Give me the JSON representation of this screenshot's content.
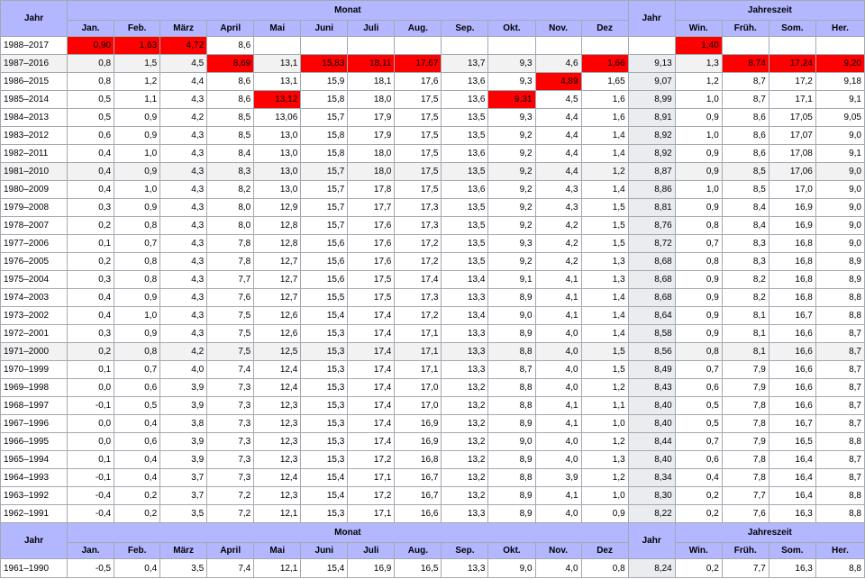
{
  "headers": {
    "jahr": "Jahr",
    "monat": "Monat",
    "jahreszeit": "Jahreszeit",
    "months": [
      "Jan.",
      "Feb.",
      "März",
      "April",
      "Mai",
      "Juni",
      "Juli",
      "Aug.",
      "Sep.",
      "Okt.",
      "Nov.",
      "Dez"
    ],
    "seasons": [
      "Win.",
      "Früh.",
      "Som.",
      "Her."
    ]
  },
  "highlight_color": "#ff0000",
  "rows": [
    {
      "period": "1988–2017",
      "months": [
        "0,90",
        "1,63",
        "4,72",
        "8,6",
        "",
        "",
        "",
        "",
        "",
        "",
        "",
        ""
      ],
      "jahr": "",
      "seasons": [
        "1,40",
        "",
        "",
        ""
      ],
      "red": [
        0,
        1,
        2,
        13
      ],
      "alt": false
    },
    {
      "period": "1987–2016",
      "months": [
        "0,8",
        "1,5",
        "4,5",
        "8,69",
        "13,1",
        "15,83",
        "18,11",
        "17,67",
        "13,7",
        "9,3",
        "4,6",
        "1,66"
      ],
      "jahr": "9,13",
      "seasons": [
        "1,3",
        "8,74",
        "17,24",
        "9,20"
      ],
      "red": [
        3,
        5,
        6,
        7,
        11,
        14,
        15,
        16
      ],
      "alt": true
    },
    {
      "period": "1986–2015",
      "months": [
        "0,8",
        "1,2",
        "4,4",
        "8,6",
        "13,1",
        "15,9",
        "18,1",
        "17,6",
        "13,6",
        "9,3",
        "4,89",
        "1,65"
      ],
      "jahr": "9,07",
      "seasons": [
        "1,2",
        "8,7",
        "17,2",
        "9,18"
      ],
      "red": [
        10
      ],
      "alt": false
    },
    {
      "period": "1985–2014",
      "months": [
        "0,5",
        "1,1",
        "4,3",
        "8,6",
        "13,12",
        "15,8",
        "18,0",
        "17,5",
        "13,6",
        "9,31",
        "4,5",
        "1,6"
      ],
      "jahr": "8,99",
      "seasons": [
        "1,0",
        "8,7",
        "17,1",
        "9,1"
      ],
      "red": [
        4,
        9
      ],
      "alt": false
    },
    {
      "period": "1984–2013",
      "months": [
        "0,5",
        "0,9",
        "4,2",
        "8,5",
        "13,06",
        "15,7",
        "17,9",
        "17,5",
        "13,5",
        "9,3",
        "4,4",
        "1,6"
      ],
      "jahr": "8,91",
      "seasons": [
        "0,9",
        "8,6",
        "17,05",
        "9,05"
      ],
      "red": [],
      "alt": false
    },
    {
      "period": "1983–2012",
      "months": [
        "0,6",
        "0,9",
        "4,3",
        "8,5",
        "13,0",
        "15,8",
        "17,9",
        "17,5",
        "13,5",
        "9,2",
        "4,4",
        "1,4"
      ],
      "jahr": "8,92",
      "seasons": [
        "1,0",
        "8,6",
        "17,07",
        "9,0"
      ],
      "red": [],
      "alt": false
    },
    {
      "period": "1982–2011",
      "months": [
        "0,4",
        "1,0",
        "4,3",
        "8,4",
        "13,0",
        "15,8",
        "18,0",
        "17,5",
        "13,6",
        "9,2",
        "4,4",
        "1,4"
      ],
      "jahr": "8,92",
      "seasons": [
        "0,9",
        "8,6",
        "17,08",
        "9,1"
      ],
      "red": [],
      "alt": false
    },
    {
      "period": "1981–2010",
      "months": [
        "0,4",
        "0,9",
        "4,3",
        "8,3",
        "13,0",
        "15,7",
        "18,0",
        "17,5",
        "13,5",
        "9,2",
        "4,4",
        "1,2"
      ],
      "jahr": "8,87",
      "seasons": [
        "0,9",
        "8,5",
        "17,06",
        "9,0"
      ],
      "red": [],
      "alt": true
    },
    {
      "period": "1980–2009",
      "months": [
        "0,4",
        "1,0",
        "4,3",
        "8,2",
        "13,0",
        "15,7",
        "17,8",
        "17,5",
        "13,6",
        "9,2",
        "4,3",
        "1,4"
      ],
      "jahr": "8,86",
      "seasons": [
        "1,0",
        "8,5",
        "17,0",
        "9,0"
      ],
      "red": [],
      "alt": false
    },
    {
      "period": "1979–2008",
      "months": [
        "0,3",
        "0,9",
        "4,3",
        "8,0",
        "12,9",
        "15,7",
        "17,7",
        "17,3",
        "13,5",
        "9,2",
        "4,3",
        "1,5"
      ],
      "jahr": "8,81",
      "seasons": [
        "0,9",
        "8,4",
        "16,9",
        "9,0"
      ],
      "red": [],
      "alt": false
    },
    {
      "period": "1978–2007",
      "months": [
        "0,2",
        "0,8",
        "4,3",
        "8,0",
        "12,8",
        "15,7",
        "17,6",
        "17,3",
        "13,5",
        "9,2",
        "4,2",
        "1,5"
      ],
      "jahr": "8,76",
      "seasons": [
        "0,8",
        "8,4",
        "16,9",
        "9,0"
      ],
      "red": [],
      "alt": false
    },
    {
      "period": "1977–2006",
      "months": [
        "0,1",
        "0,7",
        "4,3",
        "7,8",
        "12,8",
        "15,6",
        "17,6",
        "17,2",
        "13,5",
        "9,3",
        "4,2",
        "1,5"
      ],
      "jahr": "8,72",
      "seasons": [
        "0,7",
        "8,3",
        "16,8",
        "9,0"
      ],
      "red": [],
      "alt": false
    },
    {
      "period": "1976–2005",
      "months": [
        "0,2",
        "0,8",
        "4,3",
        "7,8",
        "12,7",
        "15,6",
        "17,6",
        "17,2",
        "13,5",
        "9,2",
        "4,2",
        "1,3"
      ],
      "jahr": "8,68",
      "seasons": [
        "0,8",
        "8,3",
        "16,8",
        "8,9"
      ],
      "red": [],
      "alt": false
    },
    {
      "period": "1975–2004",
      "months": [
        "0,3",
        "0,8",
        "4,3",
        "7,7",
        "12,7",
        "15,6",
        "17,5",
        "17,4",
        "13,4",
        "9,1",
        "4,1",
        "1,3"
      ],
      "jahr": "8,68",
      "seasons": [
        "0,9",
        "8,2",
        "16,8",
        "8,9"
      ],
      "red": [],
      "alt": false
    },
    {
      "period": "1974–2003",
      "months": [
        "0,4",
        "0,9",
        "4,3",
        "7,6",
        "12,7",
        "15,5",
        "17,5",
        "17,3",
        "13,3",
        "8,9",
        "4,1",
        "1,4"
      ],
      "jahr": "8,68",
      "seasons": [
        "0,9",
        "8,2",
        "16,8",
        "8,8"
      ],
      "red": [],
      "alt": false
    },
    {
      "period": "1973–2002",
      "months": [
        "0,4",
        "1,0",
        "4,3",
        "7,5",
        "12,6",
        "15,4",
        "17,4",
        "17,2",
        "13,4",
        "9,0",
        "4,1",
        "1,4"
      ],
      "jahr": "8,64",
      "seasons": [
        "0,9",
        "8,1",
        "16,7",
        "8,8"
      ],
      "red": [],
      "alt": false
    },
    {
      "period": "1972–2001",
      "months": [
        "0,3",
        "0,9",
        "4,3",
        "7,5",
        "12,6",
        "15,3",
        "17,4",
        "17,1",
        "13,3",
        "8,9",
        "4,0",
        "1,4"
      ],
      "jahr": "8,58",
      "seasons": [
        "0,9",
        "8,1",
        "16,6",
        "8,7"
      ],
      "red": [],
      "alt": false
    },
    {
      "period": "1971–2000",
      "months": [
        "0,2",
        "0,8",
        "4,2",
        "7,5",
        "12,5",
        "15,3",
        "17,4",
        "17,1",
        "13,3",
        "8,8",
        "4,0",
        "1,5"
      ],
      "jahr": "8,56",
      "seasons": [
        "0,8",
        "8,1",
        "16,6",
        "8,7"
      ],
      "red": [],
      "alt": true
    },
    {
      "period": "1970–1999",
      "months": [
        "0,1",
        "0,7",
        "4,0",
        "7,4",
        "12,4",
        "15,3",
        "17,4",
        "17,1",
        "13,3",
        "8,7",
        "4,0",
        "1,5"
      ],
      "jahr": "8,49",
      "seasons": [
        "0,7",
        "7,9",
        "16,6",
        "8,7"
      ],
      "red": [],
      "alt": false
    },
    {
      "period": "1969–1998",
      "months": [
        "0,0",
        "0,6",
        "3,9",
        "7,3",
        "12,4",
        "15,3",
        "17,4",
        "17,0",
        "13,2",
        "8,8",
        "4,0",
        "1,2"
      ],
      "jahr": "8,43",
      "seasons": [
        "0,6",
        "7,9",
        "16,6",
        "8,7"
      ],
      "red": [],
      "alt": false
    },
    {
      "period": "1968–1997",
      "months": [
        "-0,1",
        "0,5",
        "3,9",
        "7,3",
        "12,3",
        "15,3",
        "17,4",
        "17,0",
        "13,2",
        "8,8",
        "4,1",
        "1,1"
      ],
      "jahr": "8,40",
      "seasons": [
        "0,5",
        "7,8",
        "16,6",
        "8,7"
      ],
      "red": [],
      "alt": false
    },
    {
      "period": "1967–1996",
      "months": [
        "0,0",
        "0,4",
        "3,8",
        "7,3",
        "12,3",
        "15,3",
        "17,4",
        "16,9",
        "13,2",
        "8,9",
        "4,1",
        "1,0"
      ],
      "jahr": "8,40",
      "seasons": [
        "0,5",
        "7,8",
        "16,7",
        "8,7"
      ],
      "red": [],
      "alt": false
    },
    {
      "period": "1966–1995",
      "months": [
        "0,0",
        "0,6",
        "3,9",
        "7,3",
        "12,3",
        "15,3",
        "17,4",
        "16,9",
        "13,2",
        "9,0",
        "4,0",
        "1,2"
      ],
      "jahr": "8,44",
      "seasons": [
        "0,7",
        "7,9",
        "16,5",
        "8,8"
      ],
      "red": [],
      "alt": false
    },
    {
      "period": "1965–1994",
      "months": [
        "0,1",
        "0,4",
        "3,9",
        "7,3",
        "12,3",
        "15,3",
        "17,2",
        "16,8",
        "13,2",
        "8,9",
        "4,0",
        "1,3"
      ],
      "jahr": "8,40",
      "seasons": [
        "0,6",
        "7,8",
        "16,4",
        "8,7"
      ],
      "red": [],
      "alt": false
    },
    {
      "period": "1964–1993",
      "months": [
        "-0,1",
        "0,4",
        "3,7",
        "7,3",
        "12,4",
        "15,4",
        "17,1",
        "16,7",
        "13,2",
        "8,8",
        "3,9",
        "1,2"
      ],
      "jahr": "8,34",
      "seasons": [
        "0,4",
        "7,8",
        "16,4",
        "8,7"
      ],
      "red": [],
      "alt": false
    },
    {
      "period": "1963–1992",
      "months": [
        "-0,4",
        "0,2",
        "3,7",
        "7,2",
        "12,3",
        "15,4",
        "17,2",
        "16,7",
        "13,2",
        "8,9",
        "4,1",
        "1,0"
      ],
      "jahr": "8,30",
      "seasons": [
        "0,2",
        "7,7",
        "16,4",
        "8,8"
      ],
      "red": [],
      "alt": false
    },
    {
      "period": "1962–1991",
      "months": [
        "-0,4",
        "0,2",
        "3,5",
        "7,2",
        "12,1",
        "15,3",
        "17,1",
        "16,6",
        "13,3",
        "8,9",
        "4,0",
        "0,9"
      ],
      "jahr": "8,22",
      "seasons": [
        "0,2",
        "7,6",
        "16,3",
        "8,8"
      ],
      "red": [],
      "alt": false
    }
  ],
  "footer_row": {
    "period": "1961–1990",
    "months": [
      "-0,5",
      "0,4",
      "3,5",
      "7,4",
      "12,1",
      "15,4",
      "16,9",
      "16,5",
      "13,3",
      "9,0",
      "4,0",
      "0,8"
    ],
    "jahr": "8,24",
    "seasons": [
      "0,2",
      "7,7",
      "16,3",
      "8,8"
    ]
  }
}
